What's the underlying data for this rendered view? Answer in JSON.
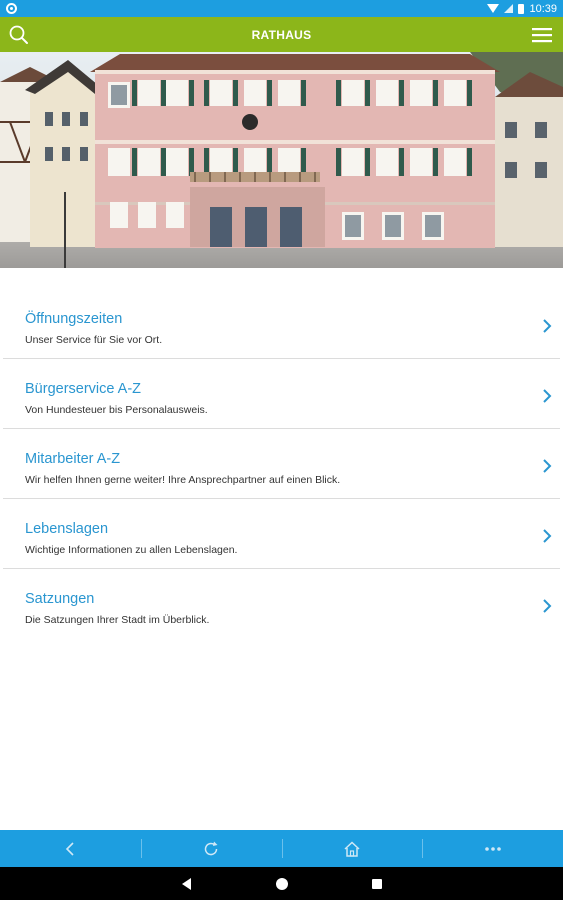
{
  "status_bar": {
    "time": "10:39",
    "icons": [
      "notification-icon",
      "wifi-icon",
      "signal-icon",
      "battery-icon"
    ]
  },
  "toolbar": {
    "title": "RATHAUS",
    "search_icon": "search-icon",
    "menu_icon": "hamburger-menu-icon",
    "background_color": "#8cb61a"
  },
  "hero": {
    "image": "town-hall-photo"
  },
  "menu": {
    "items": [
      {
        "title": "Öffnungszeiten",
        "subtitle": "Unser Service für Sie vor Ort."
      },
      {
        "title": "Bürgerservice A-Z",
        "subtitle": "Von Hundesteuer bis Personalausweis."
      },
      {
        "title": "Mitarbeiter A-Z",
        "subtitle": "Wir helfen Ihnen gerne weiter! Ihre Ansprechpartner auf einen Blick."
      },
      {
        "title": "Lebenslagen",
        "subtitle": "Wichtige Informationen zu allen Lebenslagen."
      },
      {
        "title": "Satzungen",
        "subtitle": "Die Satzungen Ihrer Stadt im Überblick."
      }
    ],
    "title_color": "#2a96d0",
    "chevron_icon": "chevron-right-icon"
  },
  "bottom_nav": {
    "buttons": [
      "back-icon",
      "refresh-icon",
      "home-icon",
      "more-icon"
    ],
    "background_color": "#1d9ee0"
  },
  "system_nav": {
    "buttons": [
      "system-back-icon",
      "system-home-icon",
      "system-recents-icon"
    ]
  }
}
